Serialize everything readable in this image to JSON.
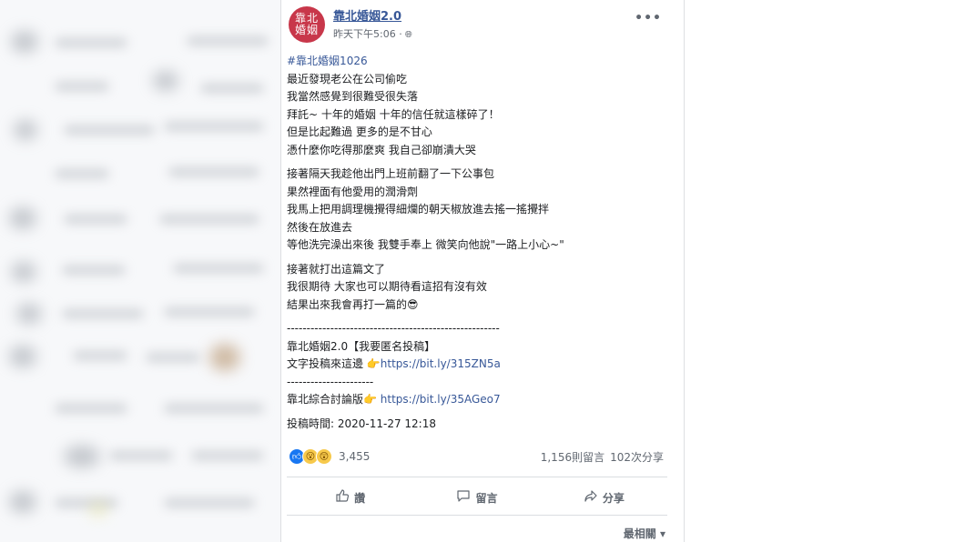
{
  "post": {
    "avatar_text": "靠北\n婚姻",
    "page_name": "靠北婚姻2.0",
    "time": "昨天下午5:06 ·",
    "hashtag": "#靠北婚姻1026",
    "paragraph1": [
      "最近發現老公在公司偷吃",
      "我當然感覺到很難受很失落",
      "拜託~ 十年的婚姻 十年的信任就這樣碎了！",
      "但是比起難過 更多的是不甘心",
      "憑什麼你吃得那麼爽 我自己卻崩潰大哭"
    ],
    "paragraph2": [
      "接著隔天我趁他出門上班前翻了一下公事包",
      "果然裡面有他愛用的潤滑劑",
      "我馬上把用調理機攪得細爛的朝天椒放進去搖一搖攪拌",
      "然後在放進去",
      "等他洗完澡出來後 我雙手奉上 微笑向他說\"一路上小心~\""
    ],
    "paragraph3": [
      "接著就打出這篇文了",
      "我很期待 大家也可以期待看這招有沒有效",
      "結果出來我會再打一篇的😎"
    ],
    "divider_long": "------------------------------------------------------",
    "submit_title": "靠北婚姻2.0【我要匿名投稿】",
    "submit_text": "文字投稿來這邊 👉",
    "submit_link": "https://bit.ly/315ZN5a",
    "divider_short": "----------------------",
    "forum_text": "靠北綜合討論版👉 ",
    "forum_link": "https://bit.ly/35AGeo7",
    "posted_time": "投稿時間: 2020-11-27 12:18"
  },
  "engagement": {
    "reaction_count": "3,455",
    "comments": "1,156則留言",
    "shares": "102次分享"
  },
  "actions": {
    "like": "讚",
    "comment": "留言",
    "share": "分享"
  },
  "sort_label": "最相關 ▾",
  "icons": {
    "globe": "globe-icon",
    "more": "more-icon",
    "like": "thumbs-up-icon",
    "comment": "speech-bubble-icon",
    "share": "share-arrow-icon"
  },
  "colors": {
    "link": "#385898",
    "avatar_bg": "#c8374a",
    "like_blue": "#1877f2"
  }
}
